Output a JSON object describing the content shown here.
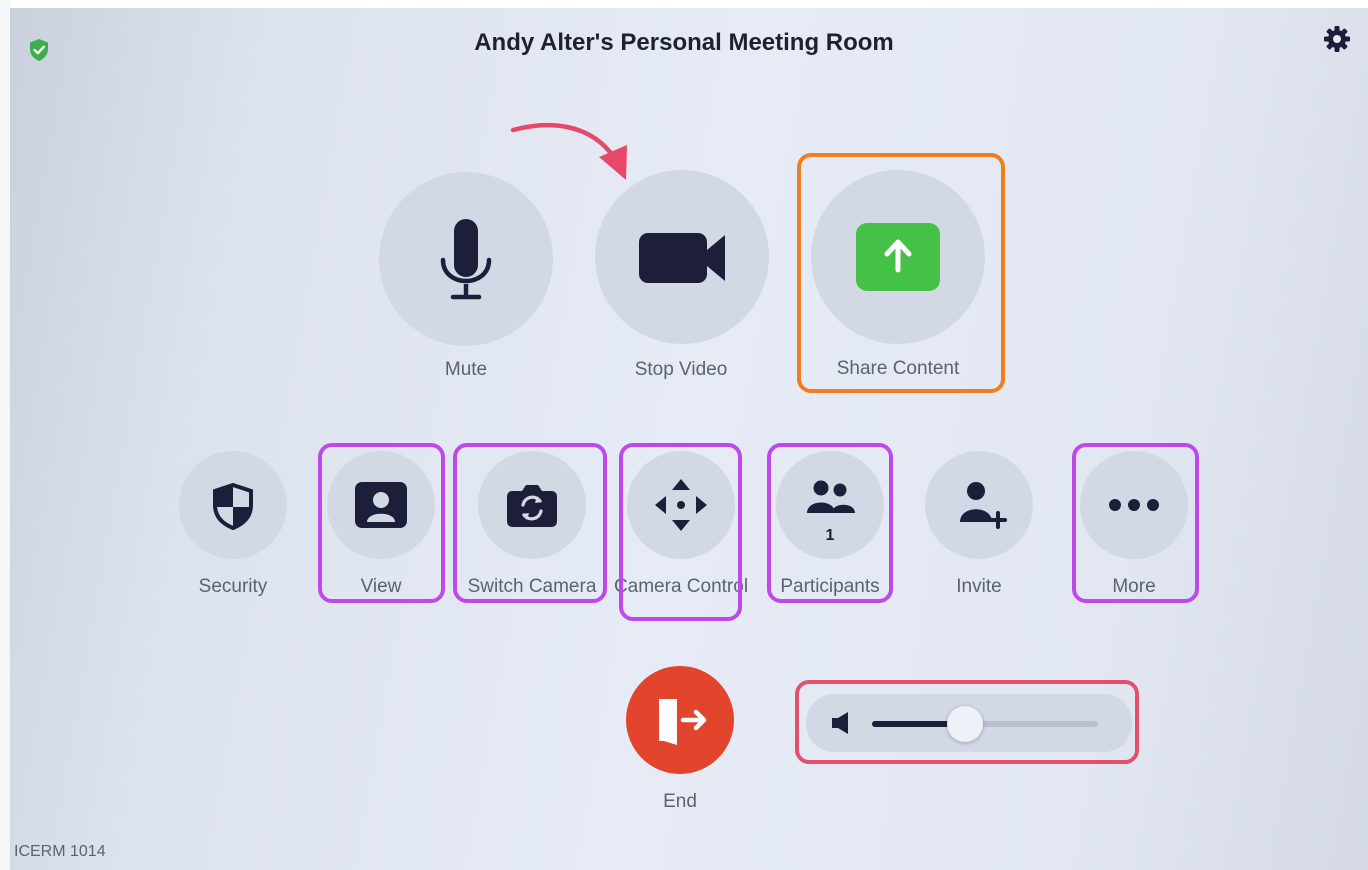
{
  "header": {
    "title": "Andy Alter's Personal Meeting Room",
    "security_badge_icon": "shield-check-icon",
    "settings_icon": "gear-icon"
  },
  "primary_controls": [
    {
      "label": "Mute",
      "icon": "microphone-icon"
    },
    {
      "label": "Stop Video",
      "icon": "video-camera-icon"
    },
    {
      "label": "Share Content",
      "icon": "share-upload-icon",
      "accent": "#44c146"
    }
  ],
  "secondary_controls": [
    {
      "label": "Security",
      "icon": "shield-icon"
    },
    {
      "label": "View",
      "icon": "user-portrait-icon"
    },
    {
      "label": "Switch Camera",
      "icon": "camera-switch-icon"
    },
    {
      "label": "Camera Control",
      "icon": "four-arrows-icon"
    },
    {
      "label": "Participants",
      "icon": "participants-icon",
      "count": "1"
    },
    {
      "label": "Invite",
      "icon": "add-user-icon"
    },
    {
      "label": "More",
      "icon": "ellipsis-icon"
    }
  ],
  "end_control": {
    "label": "End",
    "icon": "exit-door-icon",
    "color": "#e2442c"
  },
  "volume": {
    "icon": "speaker-icon",
    "level": 0.41
  },
  "footer": {
    "room_name": "ICERM 1014"
  },
  "annotation_colors": {
    "share": "#f07e1c",
    "controls": "#be49ea",
    "volume": "#e2506e",
    "arrow": "#e8476a"
  }
}
